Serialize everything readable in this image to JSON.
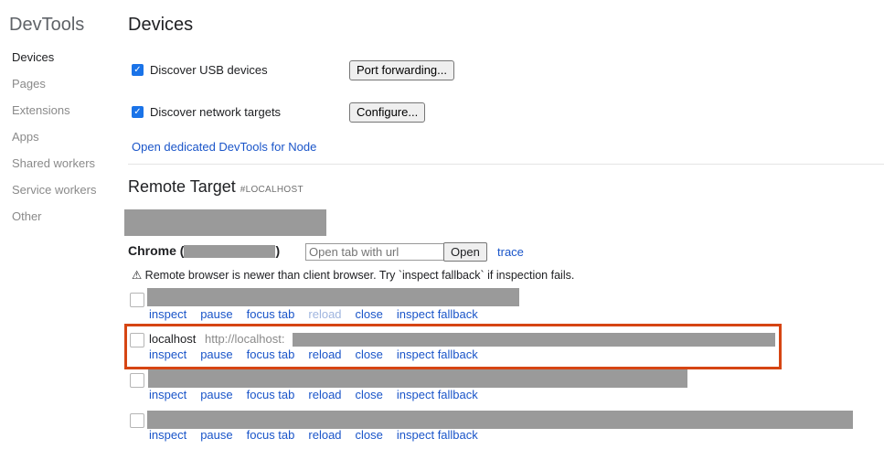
{
  "sidebar": {
    "title": "DevTools",
    "items": [
      {
        "label": "Devices",
        "active": true
      },
      {
        "label": "Pages"
      },
      {
        "label": "Extensions"
      },
      {
        "label": "Apps"
      },
      {
        "label": "Shared workers"
      },
      {
        "label": "Service workers"
      },
      {
        "label": "Other"
      }
    ]
  },
  "main": {
    "title": "Devices",
    "usb": {
      "label": "Discover USB devices",
      "checked": true,
      "button": "Port forwarding..."
    },
    "network": {
      "label": "Discover network targets",
      "checked": true,
      "button": "Configure..."
    },
    "node_link": "Open dedicated DevTools for Node",
    "remote": {
      "title": "Remote Target",
      "hash": "#LOCALHOST",
      "browser_prefix": "Chrome (",
      "browser_suffix": ")",
      "tab_placeholder": "Open tab with url",
      "open_button": "Open",
      "trace_link": "trace",
      "warning": "⚠ Remote browser is newer than client browser. Try `inspect fallback` if inspection fails.",
      "highlighted_target": {
        "name": "localhost",
        "url": "http://localhost:"
      },
      "actions": [
        "inspect",
        "pause",
        "focus tab",
        "reload",
        "close",
        "inspect fallback"
      ]
    }
  },
  "colors": {
    "link": "#1a55c9",
    "highlight": "#d64513",
    "checkbox": "#1a73e8"
  }
}
